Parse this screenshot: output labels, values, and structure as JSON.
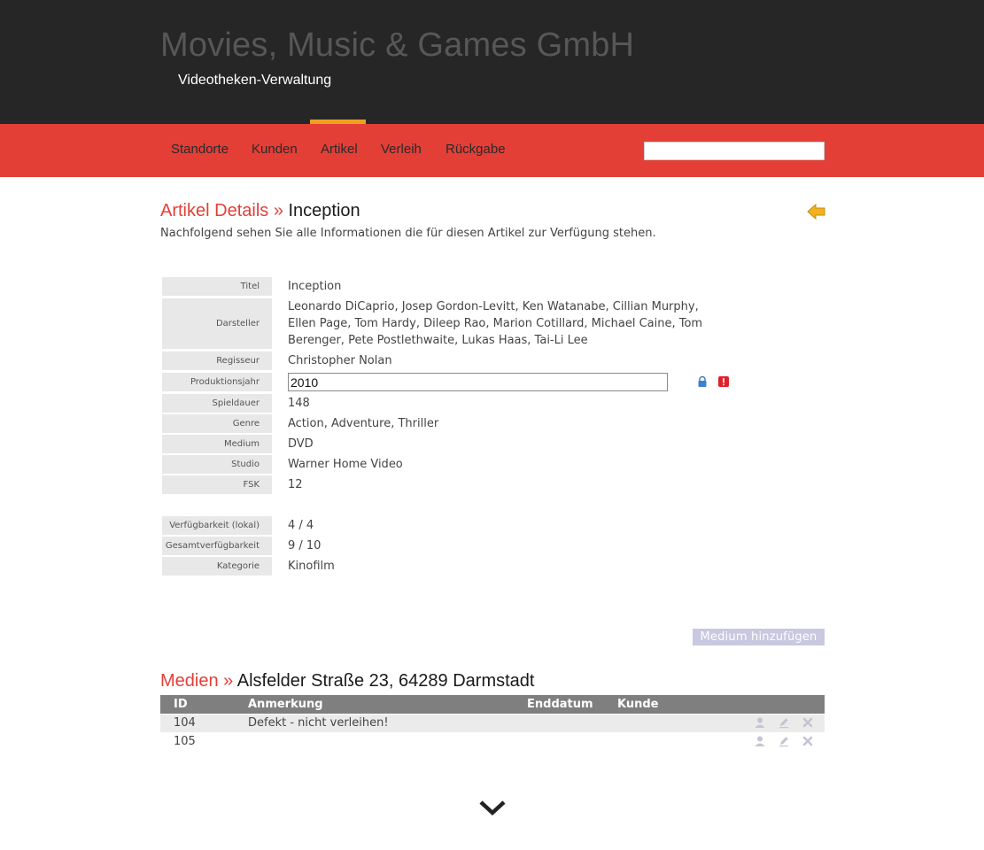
{
  "header": {
    "brand": "Movies, Music & Games GmbH",
    "subtitle": "Videotheken-Verwaltung"
  },
  "nav": {
    "items": [
      "Standorte",
      "Kunden",
      "Artikel",
      "Verleih",
      "Rückgabe"
    ],
    "active": "Artikel",
    "search_value": ""
  },
  "page": {
    "title_lead": "Artikel Details »",
    "title_name": "Inception",
    "description": "Nachfolgend sehen Sie alle Informationen die für diesen Artikel zur Verfügung stehen."
  },
  "details": {
    "titel": {
      "label": "Titel",
      "value": "Inception"
    },
    "darsteller": {
      "label": "Darsteller",
      "lines": [
        "Leonardo DiCaprio, Josep Gordon-Levitt, Ken Watanabe, Cillian Murphy,",
        "Ellen Page, Tom Hardy, Dileep Rao, Marion Cotillard, Michael Caine, Tom",
        "Berenger, Pete Postlethwaite, Lukas Haas, Tai-Li Lee"
      ]
    },
    "regisseur": {
      "label": "Regisseur",
      "value": "Christopher Nolan"
    },
    "produktionsjahr": {
      "label": "Produktionsjahr",
      "value": "2010"
    },
    "spieldauer": {
      "label": "Spieldauer",
      "value": "148"
    },
    "genre": {
      "label": "Genre",
      "value": "Action, Adventure, Thriller"
    },
    "medium": {
      "label": "Medium",
      "value": "DVD"
    },
    "studio": {
      "label": "Studio",
      "value": "Warner Home Video"
    },
    "fsk": {
      "label": "FSK",
      "value": "12"
    },
    "verfuegbarkeit_lokal": {
      "label": "Verfügbarkeit (lokal)",
      "value": "4 / 4"
    },
    "gesamtverfuegbarkeit": {
      "label": "Gesamtverfügbarkeit",
      "value": "9 / 10"
    },
    "kategorie": {
      "label": "Kategorie",
      "value": "Kinofilm"
    }
  },
  "actions": {
    "add_medium": "Medium hinzufügen"
  },
  "media": {
    "title_lead": "Medien »",
    "title_location": "Alsfelder Straße 23, 64289 Darmstadt",
    "columns": [
      "ID",
      "Anmerkung",
      "Enddatum",
      "Kunde"
    ],
    "rows": [
      {
        "id": "104",
        "anmerkung": "Defekt - nicht verleihen!",
        "enddatum": "",
        "kunde": ""
      },
      {
        "id": "105",
        "anmerkung": "",
        "enddatum": "",
        "kunde": ""
      }
    ]
  },
  "colors": {
    "header_bg": "#262626",
    "nav_bg": "#e33f37",
    "accent": "#e33f37",
    "active_indicator": "#f0a020",
    "button_bg": "#c8c8e0",
    "table_head_bg": "#7f7f7f"
  },
  "icons": {
    "back": "back-arrow-icon",
    "lock": "lock-icon",
    "warning": "warning-icon",
    "user": "user-icon",
    "edit": "edit-icon",
    "delete": "delete-icon",
    "scroll": "chevron-down-icon"
  }
}
